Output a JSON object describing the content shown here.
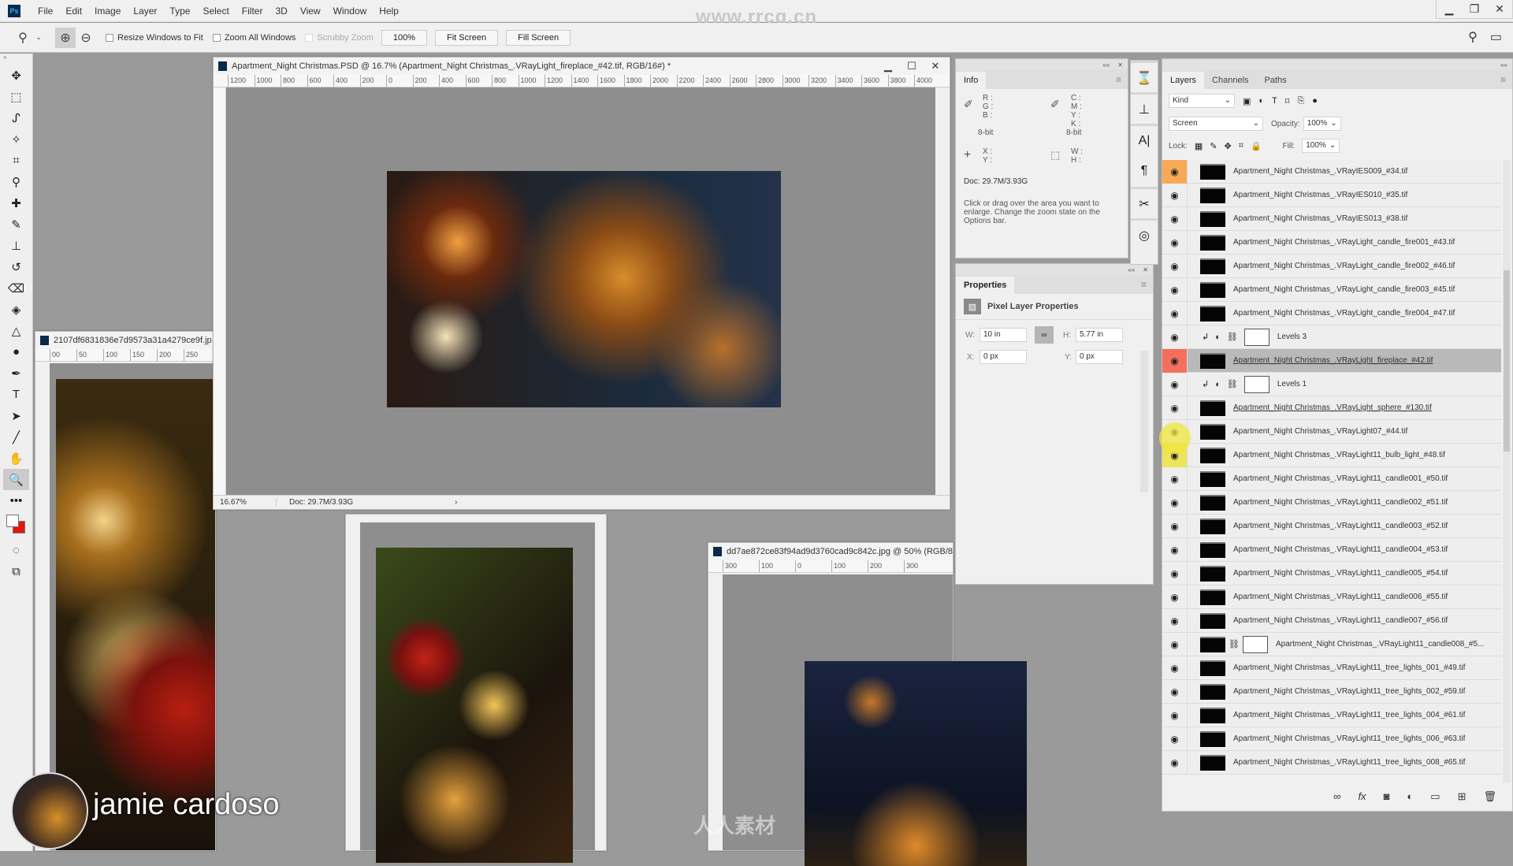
{
  "app": {
    "logo": "Ps",
    "watermark_top": "www.rrcg.cn",
    "watermark_bottom": "人人素材",
    "menu": [
      "File",
      "Edit",
      "Image",
      "Layer",
      "Type",
      "Select",
      "Filter",
      "3D",
      "View",
      "Window",
      "Help"
    ],
    "window_controls": {
      "minimize": "▁",
      "restore": "❐",
      "close": "✕"
    }
  },
  "options_bar": {
    "tool_icon": "zoom-icon",
    "zoom_in_icon": "zoom-in-icon",
    "zoom_out_icon": "zoom-out-icon",
    "resize_windows": {
      "label": "Resize Windows to Fit",
      "checked": false
    },
    "zoom_all_windows": {
      "label": "Zoom All Windows",
      "checked": false
    },
    "scrubby_zoom": {
      "label": "Scrubby Zoom",
      "checked": false,
      "disabled": true
    },
    "btn_100": "100%",
    "btn_fit": "Fit Screen",
    "btn_fill": "Fill Screen"
  },
  "tools": [
    {
      "name": "move",
      "glyph": "✥"
    },
    {
      "name": "marquee",
      "glyph": "⬚"
    },
    {
      "name": "lasso",
      "glyph": "ᔑ"
    },
    {
      "name": "magic-wand",
      "glyph": "✧"
    },
    {
      "name": "crop",
      "glyph": "⌗"
    },
    {
      "name": "eyedropper",
      "glyph": "⚲"
    },
    {
      "name": "healing",
      "glyph": "✚"
    },
    {
      "name": "brush",
      "glyph": "✎"
    },
    {
      "name": "stamp",
      "glyph": "⊥"
    },
    {
      "name": "history-brush",
      "glyph": "↺"
    },
    {
      "name": "eraser",
      "glyph": "⌫"
    },
    {
      "name": "paint-bucket",
      "glyph": "◈"
    },
    {
      "name": "blur",
      "glyph": "△"
    },
    {
      "name": "dodge",
      "glyph": "●"
    },
    {
      "name": "pen",
      "glyph": "✒"
    },
    {
      "name": "type",
      "glyph": "T"
    },
    {
      "name": "path-select",
      "glyph": "➤"
    },
    {
      "name": "line",
      "glyph": "╱"
    },
    {
      "name": "hand",
      "glyph": "✋"
    },
    {
      "name": "zoom",
      "glyph": "🔍",
      "active": true
    },
    {
      "name": "more",
      "glyph": "•••"
    }
  ],
  "colors": {
    "foreground": "#ffffff",
    "background": "#e4150b",
    "selected_eye": "#f56f5d",
    "highlight_eye": "#f7a957"
  },
  "main_doc": {
    "title": "Apartment_Night Christmas.PSD @ 16.7% (Apartment_Night Christmas_.VRayLight_fireplace_#42.tif, RGB/16#) *",
    "ruler": [
      "1200",
      "1000",
      "800",
      "600",
      "400",
      "200",
      "0",
      "200",
      "400",
      "600",
      "800",
      "1000",
      "1200",
      "1400",
      "1600",
      "1800",
      "2000",
      "2200",
      "2400",
      "2600",
      "2800",
      "3000",
      "3200",
      "3400",
      "3600",
      "3800",
      "4000"
    ],
    "zoom": "16.67%",
    "doc_size": "Doc: 29.7M/3.93G",
    "status_arrow": "›"
  },
  "doc_left": {
    "title": "2107df6831836e7d9573a31a4279ce9f.jp",
    "ruler": [
      "00",
      "50",
      "100",
      "150",
      "200",
      "250"
    ]
  },
  "doc_right": {
    "title": "dd7ae872ce83f94ad9d3760cad9c842c.jpg @ 50% (RGB/8",
    "ruler": [
      "300",
      "100",
      "0",
      "100",
      "200",
      "300"
    ]
  },
  "info_panel": {
    "tab": "Info",
    "rgb": "R :\nG :\nB :",
    "cmyk": "C :\nM :\nY :\nK :",
    "bit_left": "8-bit",
    "bit_right": "8-bit",
    "xy": "X :\nY :",
    "wh": "W :\nH :",
    "doc": "Doc: 29.7M/3.93G",
    "hint": "Click or drag over the area you want to enlarge. Change the zoom state on the Options bar."
  },
  "properties_panel": {
    "tab": "Properties",
    "heading": "Pixel Layer Properties",
    "w_label": "W:",
    "w_value": "10 in",
    "h_label": "H:",
    "h_value": "5.77 in",
    "x_label": "X:",
    "x_value": "0 px",
    "y_label": "Y:",
    "y_value": "0 px"
  },
  "layers_panel": {
    "tabs": [
      "Layers",
      "Channels",
      "Paths"
    ],
    "filter": "Kind",
    "blend_mode": "Screen",
    "opacity_label": "Opacity:",
    "opacity": "100%",
    "lock_label": "Lock:",
    "fill_label": "Fill:",
    "fill": "100%",
    "layers": [
      {
        "name": "Apartment_Night Christmas_.VRayIES009_#34.tif",
        "type": "pixel",
        "eye": "highlight"
      },
      {
        "name": "Apartment_Night Christmas_.VRayIES010_#35.tif",
        "type": "pixel"
      },
      {
        "name": "Apartment_Night Christmas_.VRayIES013_#38.tif",
        "type": "pixel"
      },
      {
        "name": "Apartment_Night  Christmas_.VRayLight_candle_fire001_#43.tif",
        "type": "pixel"
      },
      {
        "name": "Apartment_Night  Christmas_.VRayLight_candle_fire002_#46.tif",
        "type": "pixel"
      },
      {
        "name": "Apartment_Night  Christmas_.VRayLight_candle_fire003_#45.tif",
        "type": "pixel"
      },
      {
        "name": "Apartment_Night  Christmas_.VRayLight_candle_fire004_#47.tif",
        "type": "pixel"
      },
      {
        "name": "Levels 3",
        "type": "adjustment"
      },
      {
        "name": "Apartment_Night Christmas_.VRayLight_fireplace_#42.tif",
        "type": "pixel",
        "selected": true,
        "eye": "selected"
      },
      {
        "name": "Levels 1",
        "type": "adjustment"
      },
      {
        "name": "Apartment_Night Christmas_.VRayLight_sphere_#130.tif",
        "type": "pixel"
      },
      {
        "name": "Apartment_Night Christmas_.VRayLight07_#44.tif",
        "type": "pixel",
        "eye": "cursor"
      },
      {
        "name": "Apartment_Night  Christmas_.VRayLight11_bulb_light_#48.tif",
        "type": "pixel",
        "eye": "yellow"
      },
      {
        "name": "Apartment_Night  Christmas_.VRayLight11_candle001_#50.tif",
        "type": "pixel"
      },
      {
        "name": "Apartment_Night  Christmas_.VRayLight11_candle002_#51.tif",
        "type": "pixel"
      },
      {
        "name": "Apartment_Night  Christmas_.VRayLight11_candle003_#52.tif",
        "type": "pixel"
      },
      {
        "name": "Apartment_Night  Christmas_.VRayLight11_candle004_#53.tif",
        "type": "pixel"
      },
      {
        "name": "Apartment_Night  Christmas_.VRayLight11_candle005_#54.tif",
        "type": "pixel"
      },
      {
        "name": "Apartment_Night  Christmas_.VRayLight11_candle006_#55.tif",
        "type": "pixel"
      },
      {
        "name": "Apartment_Night  Christmas_.VRayLight11_candle007_#56.tif",
        "type": "pixel"
      },
      {
        "name": "Apartment_Night  Christmas_.VRayLight11_candle008_#5...",
        "type": "masked"
      },
      {
        "name": "Apartment_Night  Christmas_.VRayLight11_tree_lights_001_#49.tif",
        "type": "pixel"
      },
      {
        "name": "Apartment_Night  Christmas_.VRayLight11_tree_lights_002_#59.tif",
        "type": "pixel"
      },
      {
        "name": "Apartment_Night  Christmas_.VRayLight11_tree_lights_004_#61.tif",
        "type": "pixel"
      },
      {
        "name": "Apartment_Night  Christmas_.VRayLight11_tree_lights_006_#63.tif",
        "type": "pixel"
      },
      {
        "name": "Apartment_Night  Christmas_.VRayLight11_tree_lights_008_#65.tif",
        "type": "pixel"
      }
    ],
    "footer_icons": [
      "link-icon",
      "fx-icon",
      "mask-icon",
      "adjustment-icon",
      "folder-icon",
      "new-layer-icon",
      "trash-icon"
    ]
  },
  "presenter": {
    "name": "jamie cardoso"
  }
}
